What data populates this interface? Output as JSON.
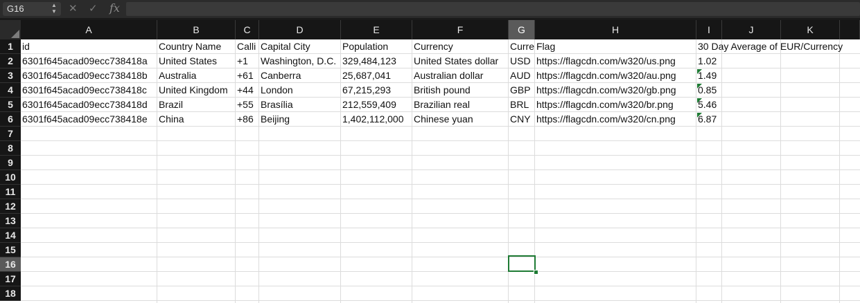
{
  "formula_bar": {
    "cell_ref": "G16",
    "cancel_icon": "✕",
    "confirm_icon": "✓",
    "fx_label": "fx",
    "formula": ""
  },
  "columns": [
    "A",
    "B",
    "C",
    "D",
    "E",
    "F",
    "G",
    "H",
    "I",
    "J",
    "K"
  ],
  "selected_column": "G",
  "rows": [
    "1",
    "2",
    "3",
    "4",
    "5",
    "6",
    "7",
    "8",
    "9",
    "10",
    "11",
    "12",
    "13",
    "14",
    "15",
    "16",
    "17",
    "18"
  ],
  "selected_row": "16",
  "sheet": {
    "header": [
      "id",
      "Country Name",
      "Calli",
      "Capital City",
      "Population",
      "Currency",
      "Curre",
      "Flag",
      "30 Day Average of EUR/Currency"
    ],
    "data": [
      [
        "6301f645acad09ecc738418a",
        "United States",
        "+1",
        "Washington, D.C.",
        "329,484,123",
        "United States dollar",
        "USD",
        "https://flagcdn.com/w320/us.png",
        "1.02"
      ],
      [
        "6301f645acad09ecc738418b",
        "Australia",
        "+61",
        "Canberra",
        "25,687,041",
        "Australian dollar",
        "AUD",
        "https://flagcdn.com/w320/au.png",
        "1.49"
      ],
      [
        "6301f645acad09ecc738418c",
        "United Kingdom",
        "+44",
        "London",
        "67,215,293",
        "British pound",
        "GBP",
        "https://flagcdn.com/w320/gb.png",
        "0.85"
      ],
      [
        "6301f645acad09ecc738418d",
        "Brazil",
        "+55",
        "Brasília",
        "212,559,409",
        "Brazilian real",
        "BRL",
        "https://flagcdn.com/w320/br.png",
        "5.46"
      ],
      [
        "6301f645acad09ecc738418e",
        "China",
        "+86",
        "Beijing",
        "1,402,112,000",
        "Chinese yuan",
        "CNY",
        "https://flagcdn.com/w320/cn.png",
        "6.87"
      ]
    ],
    "number_as_text_flags": [
      1,
      2,
      3,
      4
    ]
  },
  "colors": {
    "accent": "#1e7b34",
    "header_bg": "#161616",
    "selected_header_bg": "#5a5a5a"
  }
}
